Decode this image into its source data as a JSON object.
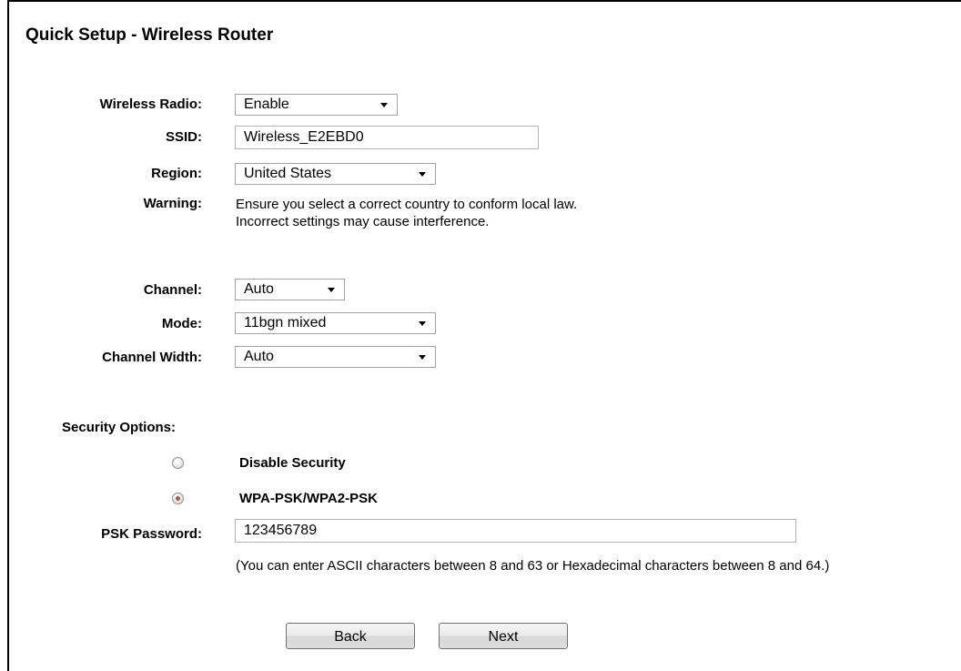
{
  "page": {
    "title": "Quick Setup - Wireless Router"
  },
  "wireless_radio": {
    "label": "Wireless Radio:",
    "value": "Enable"
  },
  "ssid": {
    "label": "SSID:",
    "value": "Wireless_E2EBD0"
  },
  "region": {
    "label": "Region:",
    "value": "United States"
  },
  "warning": {
    "label": "Warning:",
    "line1": "Ensure you select a correct country to conform local law.",
    "line2": "Incorrect settings may cause interference."
  },
  "channel": {
    "label": "Channel:",
    "value": "Auto"
  },
  "mode": {
    "label": "Mode:",
    "value": "11bgn mixed"
  },
  "channel_width": {
    "label": "Channel Width:",
    "value": "Auto"
  },
  "security": {
    "heading": "Security Options:",
    "options": [
      {
        "label": "Disable Security",
        "selected": false
      },
      {
        "label": "WPA-PSK/WPA2-PSK",
        "selected": true
      }
    ]
  },
  "psk": {
    "label": "PSK Password:",
    "value": "123456789",
    "hint": "(You can enter ASCII characters between 8 and 63 or Hexadecimal characters between 8 and 64.)"
  },
  "buttons": {
    "back": "Back",
    "next": "Next"
  },
  "colors": {
    "radio_selected": "#b8552a"
  }
}
